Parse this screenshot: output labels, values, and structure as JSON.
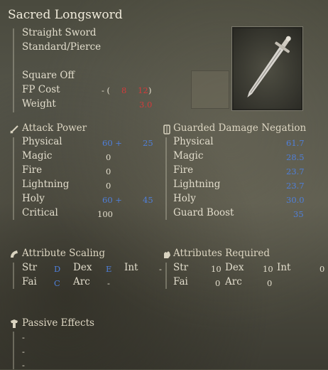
{
  "weapon": {
    "name": "Sacred Longsword",
    "type": "Straight Sword",
    "damage_type": "Standard/Pierce",
    "skill": "Square Off",
    "fp_cost_label": "FP Cost",
    "fp_cost_prefix": "- (",
    "fp_cost_a": "8",
    "fp_cost_b": "12",
    "fp_cost_suffix": ")",
    "weight_label": "Weight",
    "weight_value": "3.0"
  },
  "attack_power": {
    "title": "Attack Power",
    "rows": [
      {
        "label": "Physical",
        "base": "60 +",
        "bonus": "25"
      },
      {
        "label": "Magic",
        "base": "0",
        "bonus": ""
      },
      {
        "label": "Fire",
        "base": "0",
        "bonus": ""
      },
      {
        "label": "Lightning",
        "base": "0",
        "bonus": ""
      },
      {
        "label": "Holy",
        "base": "60 +",
        "bonus": "45"
      },
      {
        "label": "Critical",
        "base": "100",
        "bonus": ""
      }
    ]
  },
  "guarded_negation": {
    "title": "Guarded Damage Negation",
    "rows": [
      {
        "label": "Physical",
        "value": "61.7"
      },
      {
        "label": "Magic",
        "value": "28.5"
      },
      {
        "label": "Fire",
        "value": "23.7"
      },
      {
        "label": "Lightning",
        "value": "23.7"
      },
      {
        "label": "Holy",
        "value": "30.0"
      },
      {
        "label": "Guard Boost",
        "value": "35"
      }
    ]
  },
  "attribute_scaling": {
    "title": "Attribute Scaling",
    "row1": {
      "str_label": "Str",
      "str_value": "D",
      "dex_label": "Dex",
      "dex_value": "E",
      "int_label": "Int",
      "int_value": "-"
    },
    "row2": {
      "fai_label": "Fai",
      "fai_value": "C",
      "arc_label": "Arc",
      "arc_value": "-"
    }
  },
  "attributes_required": {
    "title": "Attributes Required",
    "row1": {
      "str_label": "Str",
      "str_value": "10",
      "dex_label": "Dex",
      "dex_value": "10",
      "int_label": "Int",
      "int_value": "0"
    },
    "row2": {
      "fai_label": "Fai",
      "fai_value": "0",
      "arc_label": "Arc",
      "arc_value": "0"
    }
  },
  "passive_effects": {
    "title": "Passive Effects",
    "items": [
      "-",
      "-",
      "-"
    ]
  },
  "colors": {
    "scaling_value": "#4f7fd9",
    "negative_value": "#d23b3b"
  }
}
